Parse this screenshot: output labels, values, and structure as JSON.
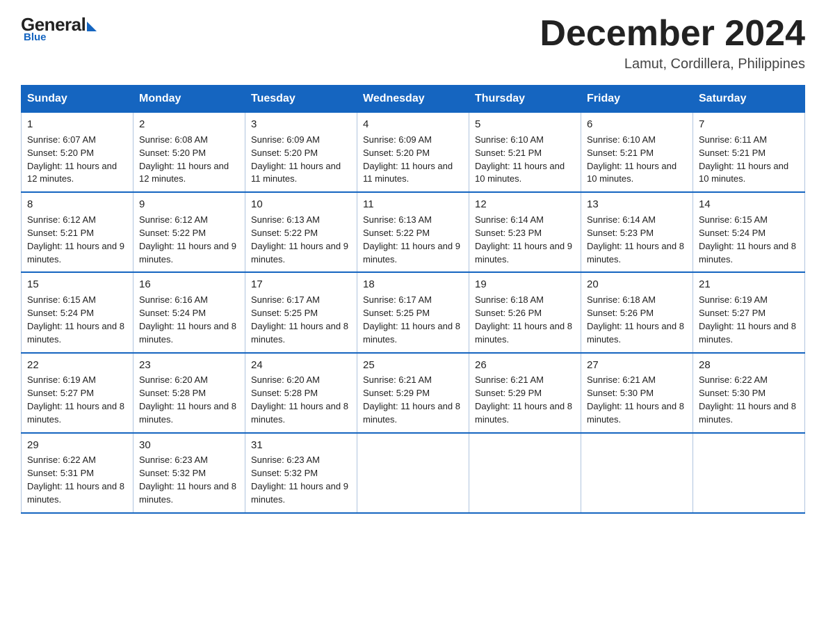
{
  "logo": {
    "general": "General",
    "blue": "Blue"
  },
  "title": "December 2024",
  "subtitle": "Lamut, Cordillera, Philippines",
  "days": [
    "Sunday",
    "Monday",
    "Tuesday",
    "Wednesday",
    "Thursday",
    "Friday",
    "Saturday"
  ],
  "weeks": [
    [
      {
        "day": "1",
        "sunrise": "6:07 AM",
        "sunset": "5:20 PM",
        "daylight": "11 hours and 12 minutes."
      },
      {
        "day": "2",
        "sunrise": "6:08 AM",
        "sunset": "5:20 PM",
        "daylight": "11 hours and 12 minutes."
      },
      {
        "day": "3",
        "sunrise": "6:09 AM",
        "sunset": "5:20 PM",
        "daylight": "11 hours and 11 minutes."
      },
      {
        "day": "4",
        "sunrise": "6:09 AM",
        "sunset": "5:20 PM",
        "daylight": "11 hours and 11 minutes."
      },
      {
        "day": "5",
        "sunrise": "6:10 AM",
        "sunset": "5:21 PM",
        "daylight": "11 hours and 10 minutes."
      },
      {
        "day": "6",
        "sunrise": "6:10 AM",
        "sunset": "5:21 PM",
        "daylight": "11 hours and 10 minutes."
      },
      {
        "day": "7",
        "sunrise": "6:11 AM",
        "sunset": "5:21 PM",
        "daylight": "11 hours and 10 minutes."
      }
    ],
    [
      {
        "day": "8",
        "sunrise": "6:12 AM",
        "sunset": "5:21 PM",
        "daylight": "11 hours and 9 minutes."
      },
      {
        "day": "9",
        "sunrise": "6:12 AM",
        "sunset": "5:22 PM",
        "daylight": "11 hours and 9 minutes."
      },
      {
        "day": "10",
        "sunrise": "6:13 AM",
        "sunset": "5:22 PM",
        "daylight": "11 hours and 9 minutes."
      },
      {
        "day": "11",
        "sunrise": "6:13 AM",
        "sunset": "5:22 PM",
        "daylight": "11 hours and 9 minutes."
      },
      {
        "day": "12",
        "sunrise": "6:14 AM",
        "sunset": "5:23 PM",
        "daylight": "11 hours and 9 minutes."
      },
      {
        "day": "13",
        "sunrise": "6:14 AM",
        "sunset": "5:23 PM",
        "daylight": "11 hours and 8 minutes."
      },
      {
        "day": "14",
        "sunrise": "6:15 AM",
        "sunset": "5:24 PM",
        "daylight": "11 hours and 8 minutes."
      }
    ],
    [
      {
        "day": "15",
        "sunrise": "6:15 AM",
        "sunset": "5:24 PM",
        "daylight": "11 hours and 8 minutes."
      },
      {
        "day": "16",
        "sunrise": "6:16 AM",
        "sunset": "5:24 PM",
        "daylight": "11 hours and 8 minutes."
      },
      {
        "day": "17",
        "sunrise": "6:17 AM",
        "sunset": "5:25 PM",
        "daylight": "11 hours and 8 minutes."
      },
      {
        "day": "18",
        "sunrise": "6:17 AM",
        "sunset": "5:25 PM",
        "daylight": "11 hours and 8 minutes."
      },
      {
        "day": "19",
        "sunrise": "6:18 AM",
        "sunset": "5:26 PM",
        "daylight": "11 hours and 8 minutes."
      },
      {
        "day": "20",
        "sunrise": "6:18 AM",
        "sunset": "5:26 PM",
        "daylight": "11 hours and 8 minutes."
      },
      {
        "day": "21",
        "sunrise": "6:19 AM",
        "sunset": "5:27 PM",
        "daylight": "11 hours and 8 minutes."
      }
    ],
    [
      {
        "day": "22",
        "sunrise": "6:19 AM",
        "sunset": "5:27 PM",
        "daylight": "11 hours and 8 minutes."
      },
      {
        "day": "23",
        "sunrise": "6:20 AM",
        "sunset": "5:28 PM",
        "daylight": "11 hours and 8 minutes."
      },
      {
        "day": "24",
        "sunrise": "6:20 AM",
        "sunset": "5:28 PM",
        "daylight": "11 hours and 8 minutes."
      },
      {
        "day": "25",
        "sunrise": "6:21 AM",
        "sunset": "5:29 PM",
        "daylight": "11 hours and 8 minutes."
      },
      {
        "day": "26",
        "sunrise": "6:21 AM",
        "sunset": "5:29 PM",
        "daylight": "11 hours and 8 minutes."
      },
      {
        "day": "27",
        "sunrise": "6:21 AM",
        "sunset": "5:30 PM",
        "daylight": "11 hours and 8 minutes."
      },
      {
        "day": "28",
        "sunrise": "6:22 AM",
        "sunset": "5:30 PM",
        "daylight": "11 hours and 8 minutes."
      }
    ],
    [
      {
        "day": "29",
        "sunrise": "6:22 AM",
        "sunset": "5:31 PM",
        "daylight": "11 hours and 8 minutes."
      },
      {
        "day": "30",
        "sunrise": "6:23 AM",
        "sunset": "5:32 PM",
        "daylight": "11 hours and 8 minutes."
      },
      {
        "day": "31",
        "sunrise": "6:23 AM",
        "sunset": "5:32 PM",
        "daylight": "11 hours and 9 minutes."
      },
      null,
      null,
      null,
      null
    ]
  ]
}
